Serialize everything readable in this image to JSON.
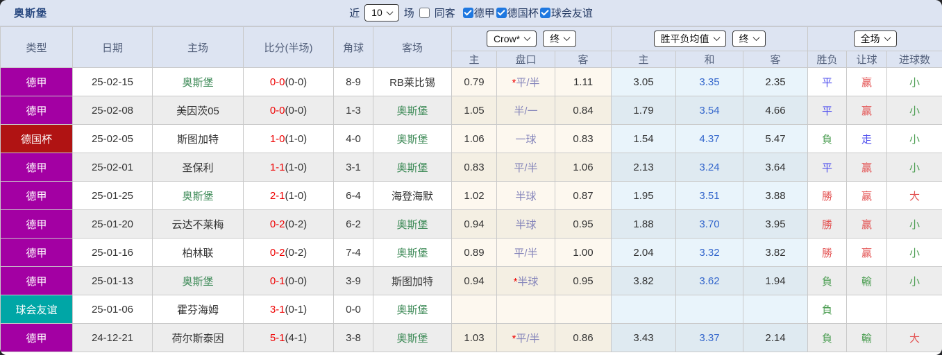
{
  "topbar": {
    "title": "奥斯堡",
    "near_label": "近",
    "recent_count": "10",
    "matches_label": "场",
    "same_away_checked": false,
    "same_away_label": "同客",
    "filters": [
      {
        "label": "德甲",
        "checked": true
      },
      {
        "label": "德国杯",
        "checked": true
      },
      {
        "label": "球会友谊",
        "checked": true
      }
    ]
  },
  "header": {
    "type": "类型",
    "date": "日期",
    "home": "主场",
    "score": "比分(半场)",
    "corners": "角球",
    "away": "客场",
    "odds_provider": "Crow*",
    "odds_state": "终",
    "avg_label": "胜平负均值",
    "avg_state": "终",
    "scope": "全场",
    "sub_home": "主",
    "sub_handicap": "盘口",
    "sub_away": "客",
    "sub_home2": "主",
    "sub_draw": "和",
    "sub_away2": "客",
    "sub_result": "胜负",
    "sub_let": "让球",
    "sub_goals": "进球数"
  },
  "colors": {
    "bundesliga_badge": "#a300a3",
    "german_cup_badge": "#b01313",
    "club_friendly_badge": "#00a6a6",
    "score_red": "#ee0000",
    "self_team_green": "#3d8a57",
    "draw_avg_blue": "#3366cc",
    "win_red": "#e35353",
    "draw_blue": "#5050ee",
    "lose_green": "#4f9f55",
    "handicap_slate": "#8484ba",
    "header_bg": "#dde4f2"
  },
  "rows": [
    {
      "type": "德甲",
      "league": "bundesliga",
      "date": "25-02-15",
      "home": "奥斯堡",
      "home_self": true,
      "score": "0-0",
      "half": "(0-0)",
      "corners": "8-9",
      "away": "RB莱比锡",
      "away_self": false,
      "crow_home": "0.79",
      "handicap_star": "*",
      "handicap": "平/半",
      "crow_away": "1.11",
      "avg_home": "3.05",
      "avg_draw": "3.35",
      "avg_away": "2.35",
      "result": "平",
      "result_color": "blue",
      "handicap_result": "赢",
      "handicap_result_color": "red",
      "goals": "小",
      "goals_color": "green"
    },
    {
      "type": "德甲",
      "league": "bundesliga",
      "date": "25-02-08",
      "home": "美因茨05",
      "home_self": false,
      "score": "0-0",
      "half": "(0-0)",
      "corners": "1-3",
      "away": "奥斯堡",
      "away_self": true,
      "crow_home": "1.05",
      "handicap_star": "",
      "handicap": "半/一",
      "crow_away": "0.84",
      "avg_home": "1.79",
      "avg_draw": "3.54",
      "avg_away": "4.66",
      "result": "平",
      "result_color": "blue",
      "handicap_result": "赢",
      "handicap_result_color": "red",
      "goals": "小",
      "goals_color": "green"
    },
    {
      "type": "德国杯",
      "league": "german-cup",
      "date": "25-02-05",
      "home": "斯图加特",
      "home_self": false,
      "score": "1-0",
      "half": "(1-0)",
      "corners": "4-0",
      "away": "奥斯堡",
      "away_self": true,
      "crow_home": "1.06",
      "handicap_star": "",
      "handicap": "一球",
      "crow_away": "0.83",
      "avg_home": "1.54",
      "avg_draw": "4.37",
      "avg_away": "5.47",
      "result": "負",
      "result_color": "green",
      "handicap_result": "走",
      "handicap_result_color": "blue",
      "goals": "小",
      "goals_color": "green"
    },
    {
      "type": "德甲",
      "league": "bundesliga",
      "date": "25-02-01",
      "home": "圣保利",
      "home_self": false,
      "score": "1-1",
      "half": "(1-0)",
      "corners": "3-1",
      "away": "奥斯堡",
      "away_self": true,
      "crow_home": "0.83",
      "handicap_star": "",
      "handicap": "平/半",
      "crow_away": "1.06",
      "avg_home": "2.13",
      "avg_draw": "3.24",
      "avg_away": "3.64",
      "result": "平",
      "result_color": "blue",
      "handicap_result": "赢",
      "handicap_result_color": "red",
      "goals": "小",
      "goals_color": "green"
    },
    {
      "type": "德甲",
      "league": "bundesliga",
      "date": "25-01-25",
      "home": "奥斯堡",
      "home_self": true,
      "score": "2-1",
      "half": "(1-0)",
      "corners": "6-4",
      "away": "海登海默",
      "away_self": false,
      "crow_home": "1.02",
      "handicap_star": "",
      "handicap": "半球",
      "crow_away": "0.87",
      "avg_home": "1.95",
      "avg_draw": "3.51",
      "avg_away": "3.88",
      "result": "勝",
      "result_color": "red",
      "handicap_result": "赢",
      "handicap_result_color": "red",
      "goals": "大",
      "goals_color": "red"
    },
    {
      "type": "德甲",
      "league": "bundesliga",
      "date": "25-01-20",
      "home": "云达不莱梅",
      "home_self": false,
      "score": "0-2",
      "half": "(0-2)",
      "corners": "6-2",
      "away": "奥斯堡",
      "away_self": true,
      "crow_home": "0.94",
      "handicap_star": "",
      "handicap": "半球",
      "crow_away": "0.95",
      "avg_home": "1.88",
      "avg_draw": "3.70",
      "avg_away": "3.95",
      "result": "勝",
      "result_color": "red",
      "handicap_result": "赢",
      "handicap_result_color": "red",
      "goals": "小",
      "goals_color": "green"
    },
    {
      "type": "德甲",
      "league": "bundesliga",
      "date": "25-01-16",
      "home": "柏林联",
      "home_self": false,
      "score": "0-2",
      "half": "(0-2)",
      "corners": "7-4",
      "away": "奥斯堡",
      "away_self": true,
      "crow_home": "0.89",
      "handicap_star": "",
      "handicap": "平/半",
      "crow_away": "1.00",
      "avg_home": "2.04",
      "avg_draw": "3.32",
      "avg_away": "3.82",
      "result": "勝",
      "result_color": "red",
      "handicap_result": "赢",
      "handicap_result_color": "red",
      "goals": "小",
      "goals_color": "green"
    },
    {
      "type": "德甲",
      "league": "bundesliga",
      "date": "25-01-13",
      "home": "奥斯堡",
      "home_self": true,
      "score": "0-1",
      "half": "(0-0)",
      "corners": "3-9",
      "away": "斯图加特",
      "away_self": false,
      "crow_home": "0.94",
      "handicap_star": "*",
      "handicap": "半球",
      "crow_away": "0.95",
      "avg_home": "3.82",
      "avg_draw": "3.62",
      "avg_away": "1.94",
      "result": "負",
      "result_color": "green",
      "handicap_result": "輸",
      "handicap_result_color": "green",
      "goals": "小",
      "goals_color": "green"
    },
    {
      "type": "球会友谊",
      "league": "club-friendly",
      "date": "25-01-06",
      "home": "霍芬海姆",
      "home_self": false,
      "score": "3-1",
      "half": "(0-1)",
      "corners": "0-0",
      "away": "奥斯堡",
      "away_self": true,
      "crow_home": "",
      "handicap_star": "",
      "handicap": "",
      "crow_away": "",
      "avg_home": "",
      "avg_draw": "",
      "avg_away": "",
      "result": "負",
      "result_color": "green",
      "handicap_result": "",
      "handicap_result_color": "",
      "goals": "",
      "goals_color": ""
    },
    {
      "type": "德甲",
      "league": "bundesliga",
      "date": "24-12-21",
      "home": "荷尔斯泰因",
      "home_self": false,
      "score": "5-1",
      "half": "(4-1)",
      "corners": "3-8",
      "away": "奥斯堡",
      "away_self": true,
      "crow_home": "1.03",
      "handicap_star": "*",
      "handicap": "平/半",
      "crow_away": "0.86",
      "avg_home": "3.43",
      "avg_draw": "3.37",
      "avg_away": "2.14",
      "result": "負",
      "result_color": "green",
      "handicap_result": "輸",
      "handicap_result_color": "green",
      "goals": "大",
      "goals_color": "red"
    }
  ]
}
